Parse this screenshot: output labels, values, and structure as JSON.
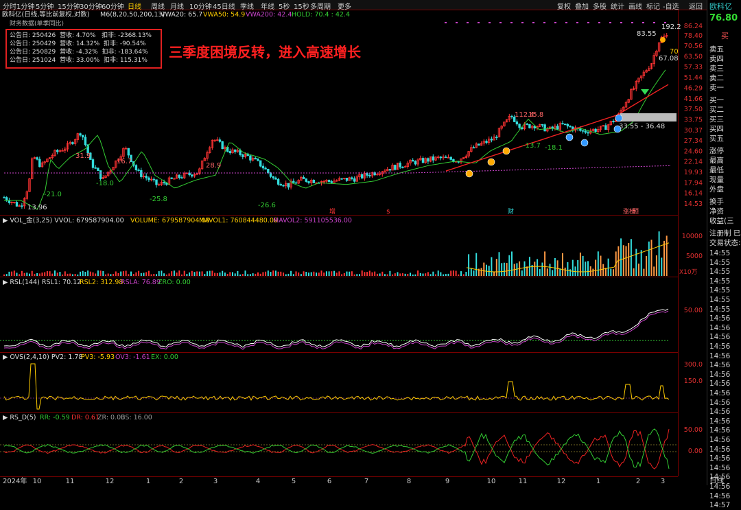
{
  "toolbar": {
    "left_items": [
      "分时",
      "1分钟",
      "5分钟",
      "15分钟",
      "30分钟",
      "60分钟",
      "日线",
      "周线",
      "月线",
      "10分钟",
      "45日线",
      "季线",
      "年线",
      "5秒",
      "15秒",
      "多周期",
      "更多"
    ],
    "active_item": "日线",
    "right_items": [
      "复权",
      "叠加",
      "多股",
      "统计",
      "画线",
      "标记",
      "-自选",
      "返回"
    ]
  },
  "header": {
    "title": "欧科亿(日线,等比前复权,对数)",
    "m6": "M6(8,20,50,200,13)",
    "vwa20": "VWA20: 65.7",
    "vwa50": "VWA50: 54.9",
    "vwa200": "VWA200: 42.4",
    "hold": "HOLD: 70.4 : 42.4",
    "fin_title": "财务数据(单季同比)"
  },
  "financials": [
    {
      "date": "公告日: 250426",
      "rev": "营收:  4.70%",
      "np": "扣非:  -2368.13%"
    },
    {
      "date": "公告日: 250429",
      "rev": "营收:  14.32%",
      "np": "扣非:  -90.54%"
    },
    {
      "date": "公告日: 250829",
      "rev": "营收:  -4.32%",
      "np": "扣非:  -183.64%"
    },
    {
      "date": "公告日: 251024",
      "rev": "营收:  33.00%",
      "np": "扣非:  115.31%"
    }
  ],
  "headline": "三季度困境反转，进入高速增长",
  "colors": {
    "up": "#ff3333",
    "down": "#33dddd",
    "green": "#33cc33",
    "purple": "#cc44cc",
    "yellow": "#ffcc00",
    "red_line": "#ee2222",
    "grid": "#7a0000"
  },
  "chart_data": [
    {
      "type": "line",
      "title": "欧科亿(日线,等比前复权,对数)",
      "log_scale": true,
      "ylim": [
        14.53,
        86.24
      ],
      "y_ticks": [
        "86.24",
        "78.40",
        "70.56",
        "63.50",
        "57.33",
        "51.44",
        "46.29",
        "41.66",
        "37.50",
        "33.75",
        "30.37",
        "27.34",
        "24.60",
        "22.14",
        "19.93",
        "17.94",
        "16.14",
        "14.53"
      ],
      "x_ticks": [
        "2024年",
        "10",
        "11",
        "12",
        "1",
        "2",
        "3",
        "4",
        "5",
        "6",
        "7",
        "8",
        "9",
        "10",
        "11",
        "12",
        "1",
        "2",
        "3"
      ],
      "price_series": [
        {
          "m": "2024-09",
          "v": 14.5
        },
        {
          "m": "2024-09b",
          "v": 13.96
        },
        {
          "m": "2024-10",
          "v": 22.0
        },
        {
          "m": "2024-10b",
          "v": 21.0
        },
        {
          "m": "2024-11",
          "v": 28.0
        },
        {
          "m": "2024-11b",
          "v": 31.9
        },
        {
          "m": "2024-12",
          "v": 18.0
        },
        {
          "m": "2024-12b",
          "v": 26.0
        },
        {
          "m": "2025-01",
          "v": 16.7
        },
        {
          "m": "2025-01b",
          "v": 25.8
        },
        {
          "m": "2025-02",
          "v": 21.0
        },
        {
          "m": "2025-03",
          "v": 28.9
        },
        {
          "m": "2025-04",
          "v": 26.6
        },
        {
          "m": "2025-05",
          "v": 20.5
        },
        {
          "m": "2025-06",
          "v": 19.0
        },
        {
          "m": "2025-07",
          "v": 21.0
        },
        {
          "m": "2025-08",
          "v": 22.0
        },
        {
          "m": "2025-09",
          "v": 24.0
        },
        {
          "m": "2025-10",
          "v": 30.0
        },
        {
          "m": "2025-10b",
          "v": 112.4
        },
        {
          "m": "2025-11",
          "v": 18.1
        },
        {
          "m": "2025-12",
          "v": 31.0
        },
        {
          "m": "2026-01",
          "v": 33.55
        },
        {
          "m": "2026-02",
          "v": 50.0
        },
        {
          "m": "2026-03",
          "v": 83.55
        }
      ],
      "annotations": [
        "13.96",
        "-21.0",
        "31.9",
        "-18.0",
        "16.7",
        "-25.8",
        "28.9",
        "-26.6",
        "112.4",
        "15.8",
        "-13.7",
        "-18.1",
        "33.55 - 36.48",
        "83.55",
        "192.2",
        "70",
        "67.08"
      ],
      "event_markers": [
        "增",
        "$",
        "财",
        "涨榜",
        "预"
      ]
    },
    {
      "type": "bar",
      "title": "VOL_金(3,25)",
      "vvol": "VVOL: 679587904.00",
      "volume": "VOLUME: 679587904.00",
      "mavol1": "MAVOL1: 760844480.00",
      "mavol2": "MAVOL2: 591105536.00",
      "y_ticks": [
        "10000",
        "5000"
      ],
      "unit": "X10万"
    },
    {
      "type": "line",
      "title": "RSL(144)",
      "rsl1": "RSL1: 70.12",
      "rsl2": "RSL2: 312.98",
      "rsla": "RSLA: 76.89",
      "zro": "ZRO: 0.00",
      "y_ticks": [
        "50.00"
      ]
    },
    {
      "type": "line",
      "title": "OVS(2,4,10)",
      "pv2": "PV2: 1.78",
      "pv3": "PV3: -5.93",
      "ov3": "OV3: -1.61",
      "ex": "EX: 0.00",
      "y_ticks": [
        "300.0",
        "150.0"
      ]
    },
    {
      "type": "line",
      "title": "RS_D(5)",
      "rr": "RR: -0.59",
      "dr": "DR: 0.61",
      "zr": "ZR: 0.00",
      "bs": "BS: 16.00",
      "y_ticks": [
        "50.00",
        "0.00"
      ]
    }
  ],
  "right_panel": {
    "stock_name": "欧科亿",
    "price": "76.80",
    "buy_label": "买",
    "asks": [
      "卖五",
      "卖四",
      "卖三",
      "卖二",
      "卖一"
    ],
    "bids": [
      "买一",
      "买二",
      "买三",
      "买四",
      "买五"
    ],
    "stats": [
      "涨停",
      "最高",
      "最低",
      "现量",
      "外盘"
    ],
    "stats2": [
      "换手",
      "净资",
      "收益(三"
    ],
    "reg": "注册制 已",
    "trade_status": "交易状态:",
    "times": [
      "14:55",
      "14:55",
      "14:55",
      "14:55",
      "14:55",
      "14:55",
      "14:55",
      "14:56",
      "14:56",
      "14:56",
      "14:56",
      "14:56",
      "14:56",
      "14:56",
      "14:56",
      "14:56",
      "14:56",
      "14:56",
      "14:56",
      "14:56",
      "14:56",
      "14:56",
      "14:56",
      "14:56",
      "14:56",
      "14:56",
      "14:56",
      "14:57"
    ],
    "bottom_tab": "日线"
  }
}
